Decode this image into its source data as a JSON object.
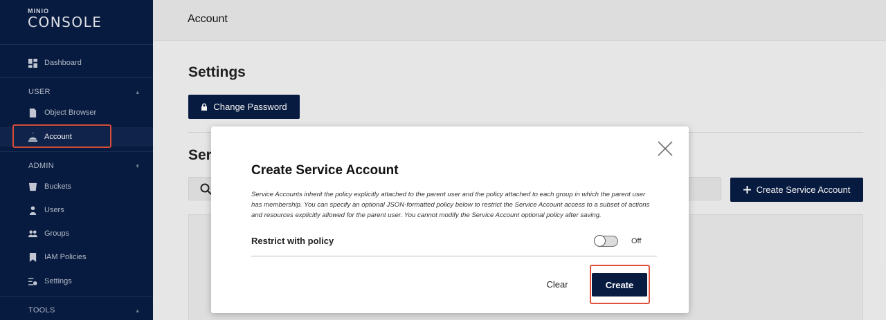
{
  "logo": {
    "small": "MINIO",
    "big": "CONSOLE"
  },
  "sidebar": {
    "dashboard": {
      "label": "Dashboard",
      "icon": "dashboard-icon"
    },
    "sections": [
      {
        "label": "USER"
      },
      {
        "label": "ADMIN"
      },
      {
        "label": "TOOLS"
      }
    ],
    "user_items": [
      {
        "label": "Object Browser",
        "icon": "document-icon"
      },
      {
        "label": "Account",
        "icon": "account-icon"
      }
    ],
    "admin_items": [
      {
        "label": "Buckets",
        "icon": "bucket-icon"
      },
      {
        "label": "Users",
        "icon": "user-icon"
      },
      {
        "label": "Groups",
        "icon": "groups-icon"
      },
      {
        "label": "IAM Policies",
        "icon": "bookmark-icon"
      },
      {
        "label": "Settings",
        "icon": "settings-icon"
      }
    ],
    "active_item": "Account"
  },
  "header": {
    "title": "Account"
  },
  "main": {
    "settings_title": "Settings",
    "change_password_label": "Change Password",
    "section_title_partial": "Ser",
    "create_service_account_label": "Create Service Account"
  },
  "modal": {
    "title": "Create Service Account",
    "description": "Service Accounts inherit the policy explicitly attached to the parent user and the policy attached to each group in which the parent user has membership. You can specify an optional JSON-formatted policy below to restrict the Service Account access to a subset of actions and resources explicitly allowed for the parent user. You cannot modify the Service Account optional policy after saving.",
    "restrict_label": "Restrict with policy",
    "toggle_state": "Off",
    "clear_label": "Clear",
    "create_label": "Create"
  },
  "colors": {
    "sidebar_bg": "#081c42",
    "highlight": "#e0503a",
    "primary_button": "#081c42"
  }
}
